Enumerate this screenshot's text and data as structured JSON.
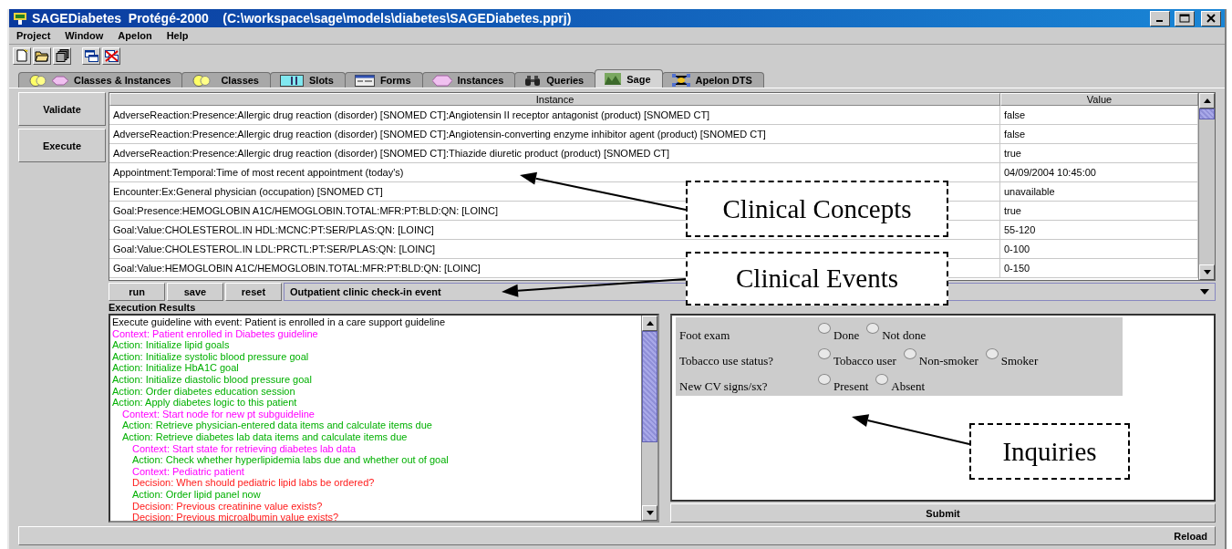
{
  "window": {
    "title": "SAGEDiabetes  Protégé-2000    (C:\\workspace\\sage\\models\\diabetes\\SAGEDiabetes.pprj)"
  },
  "menu": [
    "Project",
    "Window",
    "Apelon",
    "Help"
  ],
  "tabs": [
    {
      "label": "Classes & Instances",
      "selected": false
    },
    {
      "label": "Classes",
      "selected": false
    },
    {
      "label": "Slots",
      "selected": false
    },
    {
      "label": "Forms",
      "selected": false
    },
    {
      "label": "Instances",
      "selected": false
    },
    {
      "label": "Queries",
      "selected": false
    },
    {
      "label": "Sage",
      "selected": true
    },
    {
      "label": "Apelon DTS",
      "selected": false
    }
  ],
  "side_buttons": [
    "Validate",
    "Execute"
  ],
  "table": {
    "columns": [
      "Instance",
      "Value"
    ],
    "rows": [
      {
        "instance": "AdverseReaction:Presence:Allergic drug reaction (disorder) [SNOMED CT]:Angiotensin II receptor antagonist (product) [SNOMED CT]",
        "value": "false"
      },
      {
        "instance": "AdverseReaction:Presence:Allergic drug reaction (disorder) [SNOMED CT]:Angiotensin-converting enzyme inhibitor agent (product) [SNOMED CT]",
        "value": "false"
      },
      {
        "instance": "AdverseReaction:Presence:Allergic drug reaction (disorder) [SNOMED CT]:Thiazide diuretic product (product) [SNOMED CT]",
        "value": "true"
      },
      {
        "instance": "Appointment:Temporal:Time of most recent appointment (today's)",
        "value": "04/09/2004 10:45:00"
      },
      {
        "instance": "Encounter:Ex:General physician (occupation) [SNOMED CT]",
        "value": "unavailable"
      },
      {
        "instance": "Goal:Presence:HEMOGLOBIN A1C/HEMOGLOBIN.TOTAL:MFR:PT:BLD:QN: [LOINC]",
        "value": "true"
      },
      {
        "instance": "Goal:Value:CHOLESTEROL.IN HDL:MCNC:PT:SER/PLAS:QN: [LOINC]",
        "value": "55-120"
      },
      {
        "instance": "Goal:Value:CHOLESTEROL.IN LDL:PRCTL:PT:SER/PLAS:QN: [LOINC]",
        "value": "0-100"
      },
      {
        "instance": "Goal:Value:HEMOGLOBIN A1C/HEMOGLOBIN.TOTAL:MFR:PT:BLD:QN: [LOINC]",
        "value": "0-150"
      }
    ]
  },
  "run_buttons": [
    "run",
    "save",
    "reset"
  ],
  "event_select": {
    "value": "Outpatient clinic check-in event"
  },
  "results": {
    "title": "Execution Results",
    "lines": [
      {
        "kind": "event",
        "text": "Execute guideline with event: Patient is enrolled in a care support guideline"
      },
      {
        "kind": "context",
        "text": "Context: Patient enrolled in Diabetes guideline"
      },
      {
        "kind": "action",
        "text": "Action: Initialize lipid goals"
      },
      {
        "kind": "action",
        "text": "Action: Initialize systolic blood pressure goal"
      },
      {
        "kind": "action",
        "text": "Action: Initialize HbA1C goal"
      },
      {
        "kind": "action",
        "text": "Action: Initialize diastolic blood pressure goal"
      },
      {
        "kind": "action",
        "text": "Action: Order diabetes education session"
      },
      {
        "kind": "action",
        "text": "Action: Apply diabetes logic to this patient",
        "children": [
          {
            "kind": "context",
            "text": "Context: Start node for new pt subguideline"
          },
          {
            "kind": "action",
            "text": "Action: Retrieve physician-entered data items and calculate items due"
          },
          {
            "kind": "action",
            "text": "Action: Retrieve diabetes lab data items and calculate items due",
            "children": [
              {
                "kind": "context",
                "text": "Context: Start state for retrieving diabetes lab data"
              },
              {
                "kind": "action",
                "text": "Action: Check whether hyperlipidemia labs due and whether out of goal"
              },
              {
                "kind": "context",
                "text": "Context: Pediatric patient"
              },
              {
                "kind": "decision",
                "text": "Decision: When should pediatric lipid labs be ordered?"
              },
              {
                "kind": "action",
                "text": "Action: Order lipid panel now"
              },
              {
                "kind": "decision",
                "text": "Decision: Previous creatinine value exists?"
              },
              {
                "kind": "decision",
                "text": "Decision: Previous microalbumin value exists?"
              }
            ]
          }
        ]
      }
    ]
  },
  "inquiries": [
    {
      "question": "Foot exam",
      "options": [
        {
          "label": "Done",
          "selected": false
        },
        {
          "label": "Not done",
          "selected": false
        }
      ]
    },
    {
      "question": "Tobacco use status?",
      "options": [
        {
          "label": "Tobacco user",
          "selected": false
        },
        {
          "label": "Non-smoker",
          "selected": false
        },
        {
          "label": "Smoker",
          "selected": false
        }
      ]
    },
    {
      "question": "New CV signs/sx?",
      "options": [
        {
          "label": "Present",
          "selected": false
        },
        {
          "label": "Absent",
          "selected": false
        }
      ]
    }
  ],
  "submit_button": "Submit",
  "reload_button": "Reload",
  "annotations": [
    "Clinical Concepts",
    "Clinical Events",
    "Inquiries"
  ]
}
